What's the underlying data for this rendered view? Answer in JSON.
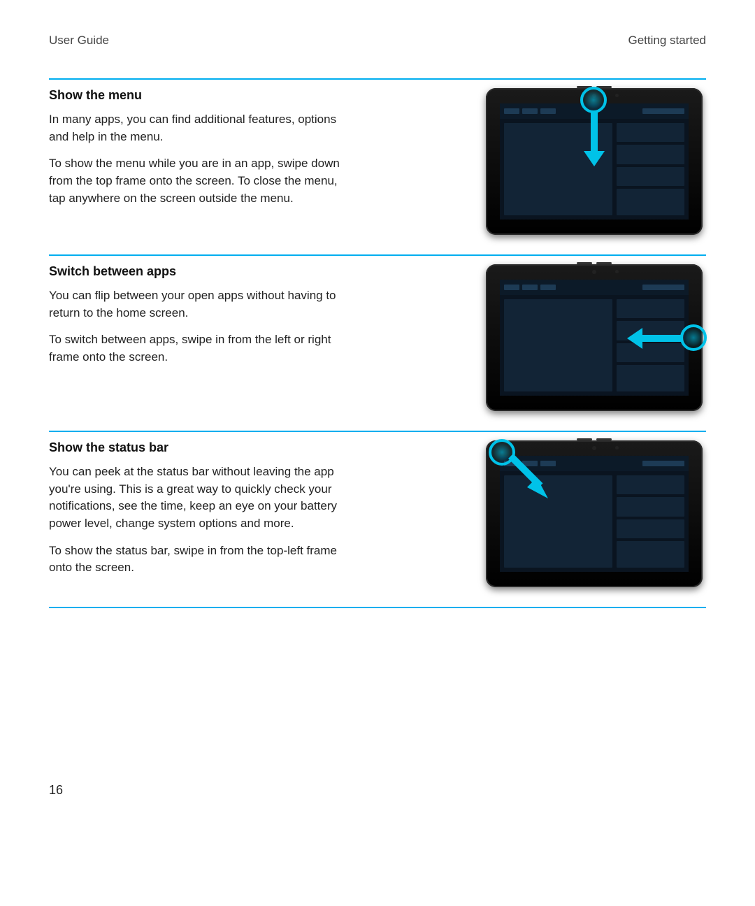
{
  "header": {
    "left": "User Guide",
    "right": "Getting started"
  },
  "sections": [
    {
      "title": "Show the menu",
      "paragraphs": [
        "In many apps, you can find additional features, options and help in the menu.",
        "To show the menu while you are in an app, swipe down from the top frame onto the screen. To close the menu, tap anywhere on the screen outside the menu."
      ]
    },
    {
      "title": "Switch between apps",
      "paragraphs": [
        "You can flip between your open apps without having to return to the home screen.",
        "To switch between apps, swipe in from the left or right frame onto the screen."
      ]
    },
    {
      "title": "Show the status bar",
      "paragraphs": [
        "You can peek at the status bar without leaving the app you're using. This is a great way to quickly check your notifications, see the time, keep an eye on your battery power level, change system options and more.",
        "To show the status bar, swipe in from the top-left frame onto the screen."
      ]
    }
  ],
  "page_number": "16"
}
